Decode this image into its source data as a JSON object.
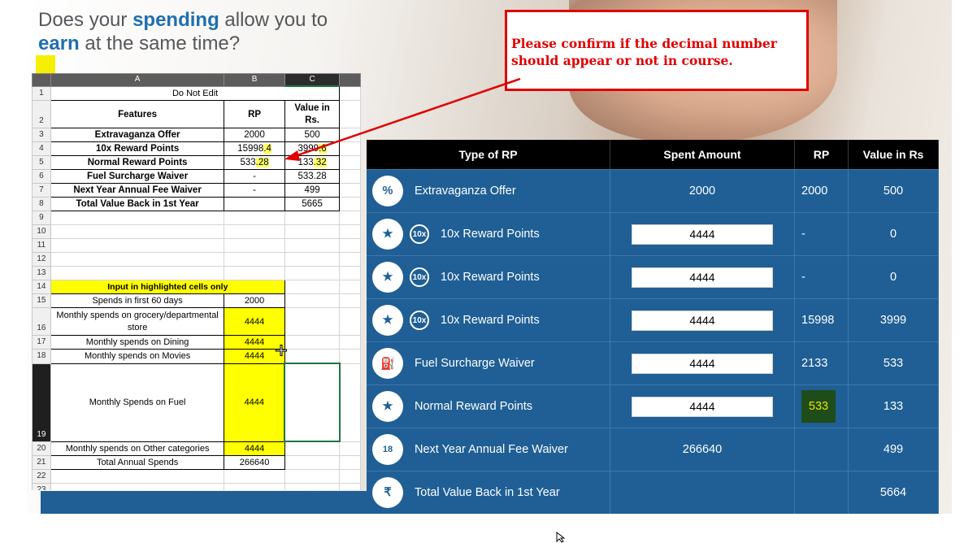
{
  "heading": {
    "part1": "Does your ",
    "word1": "spending",
    "part2": " allow you to",
    "word2": "earn",
    "part3": " at the same time?"
  },
  "callout": {
    "line1": "Please confirm if the decimal number",
    "line2": "should appear or not in course."
  },
  "sheet": {
    "columns": [
      "A",
      "B",
      "C"
    ],
    "rows": [
      {
        "n": "1",
        "a": "Do Not Edit",
        "b": "",
        "c": ""
      },
      {
        "n": "2",
        "a": "Features",
        "b": "RP",
        "c": "Value in Rs."
      },
      {
        "n": "3",
        "a": "Extravaganza Offer",
        "b": "2000",
        "c": "500"
      },
      {
        "n": "4",
        "a": "10x Reward Points",
        "b1": "15998",
        "b2": ".4",
        "c1": "3999",
        "c2": ".6"
      },
      {
        "n": "5",
        "a": "Normal Reward Points",
        "b1": "533",
        "b2": ".28",
        "c1": "133",
        "c2": ".32"
      },
      {
        "n": "6",
        "a": "Fuel Surcharge Waiver",
        "b": "-",
        "c": "533.28"
      },
      {
        "n": "7",
        "a": "Next Year Annual Fee Waiver",
        "b": "-",
        "c": "499"
      },
      {
        "n": "8",
        "a": "Total Value Back in 1st Year",
        "b": "",
        "c": "5665"
      },
      {
        "n": "9"
      },
      {
        "n": "10"
      },
      {
        "n": "11"
      },
      {
        "n": "12"
      },
      {
        "n": "13"
      },
      {
        "n": "14",
        "a": "Input in highlighted cells only"
      },
      {
        "n": "15",
        "a": "Spends in first 60 days",
        "b": "2000"
      },
      {
        "n": "16",
        "a": "Monthly spends on grocery/departmental store",
        "b": "4444"
      },
      {
        "n": "17",
        "a": "Monthly spends on Dining",
        "b": "4444"
      },
      {
        "n": "18",
        "a": "Monthly spends on Movies",
        "b": "4444"
      },
      {
        "n": "19",
        "a": "Monthly Spends on Fuel",
        "b": "4444"
      },
      {
        "n": "20",
        "a": "Monthly spends on Other categories",
        "b": "4444"
      },
      {
        "n": "21",
        "a": "Total Annual Spends",
        "b": "266640"
      },
      {
        "n": "22"
      },
      {
        "n": "23"
      }
    ]
  },
  "rp_table": {
    "headers": [
      "Type of RP",
      "Spent Amount",
      "RP",
      "Value in Rs"
    ],
    "rows": [
      {
        "icon": "percent-icon",
        "glyph": "%",
        "pill": "",
        "type": "Extravaganza Offer",
        "spent": "2000",
        "spent_input": false,
        "rp": "2000",
        "value": "500"
      },
      {
        "icon": "star-icon",
        "glyph": "★",
        "pill": "10x",
        "type": "10x Reward Points",
        "spent": "4444",
        "spent_input": true,
        "rp": "-",
        "value": "0"
      },
      {
        "icon": "star-icon",
        "glyph": "★",
        "pill": "10x",
        "type": "10x Reward Points",
        "spent": "4444",
        "spent_input": true,
        "rp": "-",
        "value": "0"
      },
      {
        "icon": "star-icon",
        "glyph": "★",
        "pill": "10x",
        "type": "10x Reward Points",
        "spent": "4444",
        "spent_input": true,
        "rp": "15998",
        "value": "3999"
      },
      {
        "icon": "fuel-pump-icon",
        "glyph": "⛽",
        "pill": "",
        "type": "Fuel Surcharge Waiver",
        "spent": "4444",
        "spent_input": true,
        "rp": "2133",
        "value": "533"
      },
      {
        "icon": "star-icon",
        "glyph": "★",
        "pill": "",
        "type": "Normal Reward Points",
        "spent": "4444",
        "spent_input": true,
        "rp": "533",
        "rp_highlight": true,
        "value": "133"
      },
      {
        "icon": "calendar-icon",
        "glyph": "18",
        "pill": "",
        "type": "Next Year Annual Fee Waiver",
        "spent": "266640",
        "spent_input": false,
        "rp": "",
        "value": "499"
      },
      {
        "icon": "rupee-icon",
        "glyph": "₹",
        "pill": "",
        "type": "Total Value Back in 1st Year",
        "spent": "",
        "spent_input": false,
        "rp": "",
        "value": "5664"
      }
    ]
  },
  "colors": {
    "panel_blue": "#1f5f95",
    "header_black": "#000000",
    "highlight_yellow": "#ffff00",
    "callout_red": "#e00000",
    "heading_blue": "#1f6fae"
  }
}
